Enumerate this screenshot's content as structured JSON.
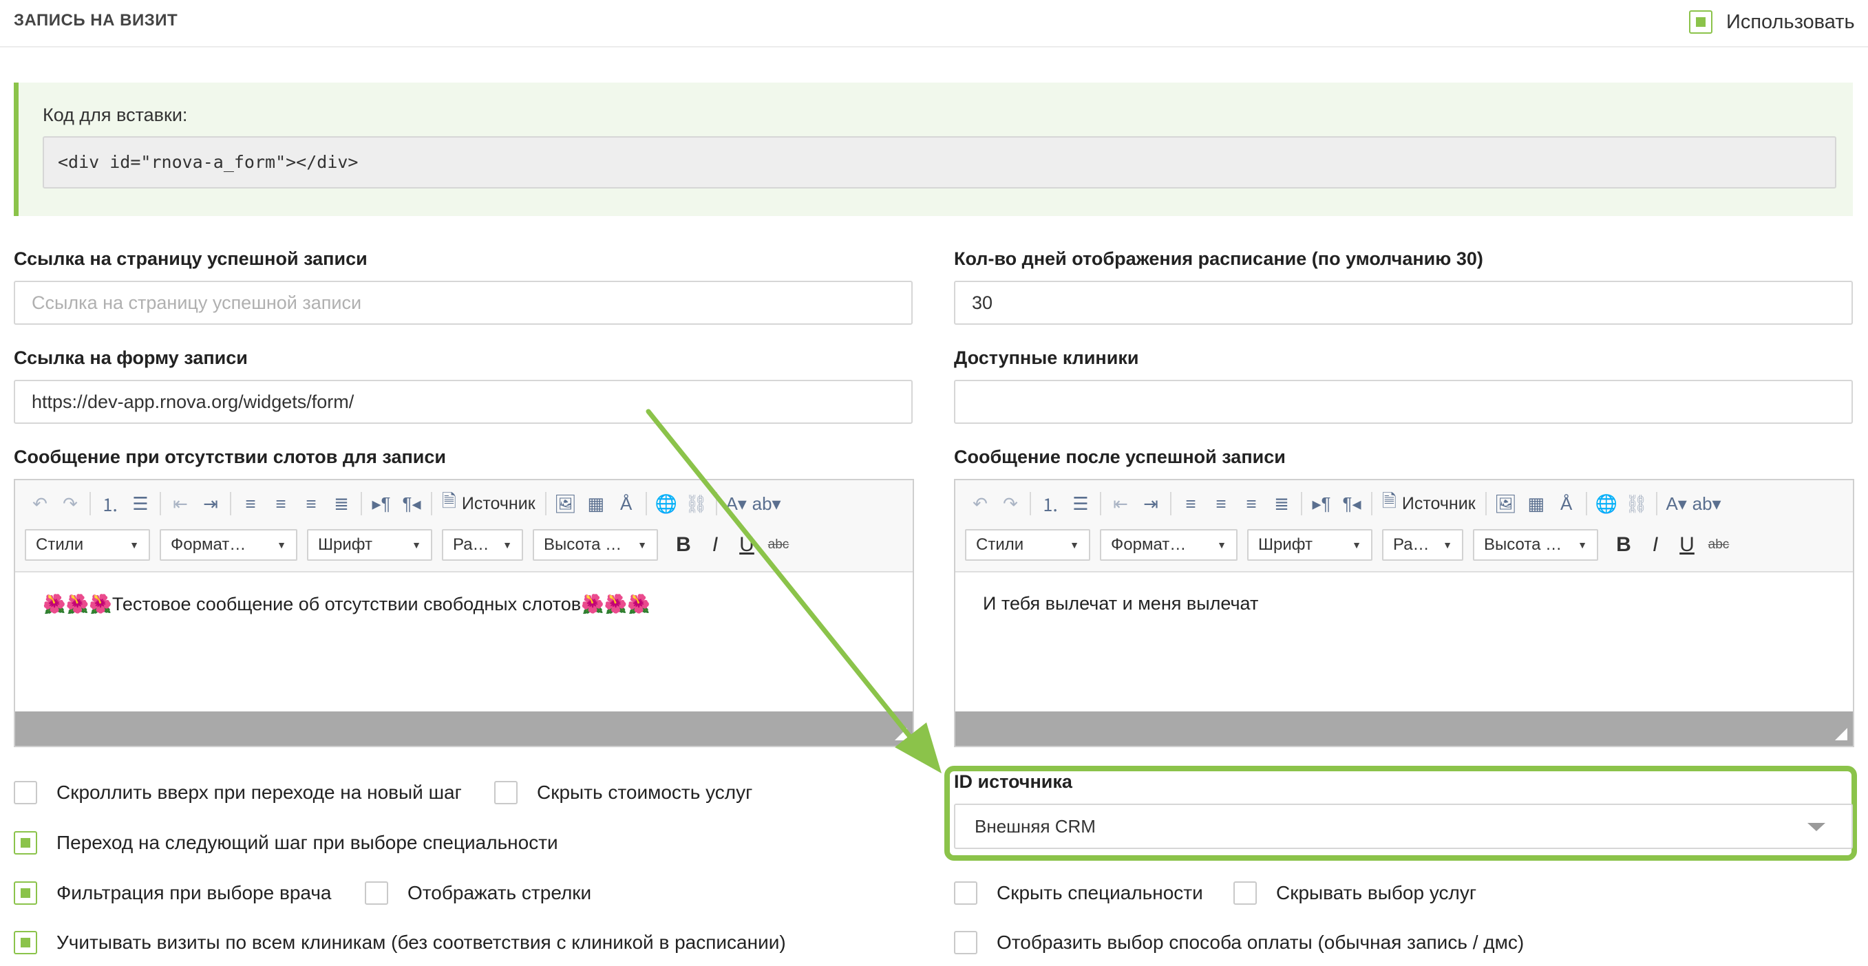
{
  "header": {
    "title": "ЗАПИСЬ НА ВИЗИТ",
    "use_label": "Использовать",
    "use_checked": true
  },
  "embed": {
    "label": "Код для вставки:",
    "code": "<div id=\"rnova-a_form\"></div>"
  },
  "success_page": {
    "label": "Ссылка на страницу успешной записи",
    "placeholder": "Ссылка на страницу успешной записи",
    "value": ""
  },
  "days": {
    "label": "Кол-во дней отображения расписание (по умолчанию 30)",
    "value": "30"
  },
  "form_link": {
    "label": "Ссылка на форму записи",
    "value": "https://dev-app.rnova.org/widgets/form/"
  },
  "clinics": {
    "label": "Доступные клиники",
    "value": ""
  },
  "toolbar": {
    "source_label": "Источник",
    "combos": [
      "Стили",
      "Формат…",
      "Шрифт",
      "Ра…",
      "Высота …"
    ],
    "bold": "B",
    "italic": "I",
    "underline": "U",
    "strike": "abc"
  },
  "editor_noslots": {
    "label": "Сообщение при отсутствии слотов для записи",
    "content": "🌺🌺🌺Тестовое сообщение об отсутствии свободных слотов🌺🌺🌺"
  },
  "editor_success": {
    "label": "Сообщение после успешной записи",
    "content": "И тебя вылечат и меня вылечат"
  },
  "options_left": [
    {
      "label": "Скроллить вверх при переходе на новый шаг",
      "checked": false
    },
    {
      "label": "Скрыть стоимость услуг",
      "checked": false
    },
    {
      "label": "Переход на следующий шаг при выборе специальности",
      "checked": true
    },
    {
      "label": "Фильтрация при выборе врача",
      "checked": true
    },
    {
      "label": "Отображать стрелки",
      "checked": false
    },
    {
      "label": "Учитывать визиты по всем клиникам (без соответствия с клиникой в расписании)",
      "checked": true
    }
  ],
  "source_id": {
    "label": "ID источника",
    "value": "Внешняя CRM"
  },
  "options_right": [
    {
      "label": "Скрыть специальности",
      "checked": false
    },
    {
      "label": "Скрывать выбор услуг",
      "checked": false
    },
    {
      "label": "Отобразить выбор способа оплаты (обычная запись / дмс)",
      "checked": false
    }
  ],
  "colors": {
    "accent": "#8bc34a",
    "embed_bg": "#f1f8ec",
    "status_bar": "#a9a9a9"
  }
}
